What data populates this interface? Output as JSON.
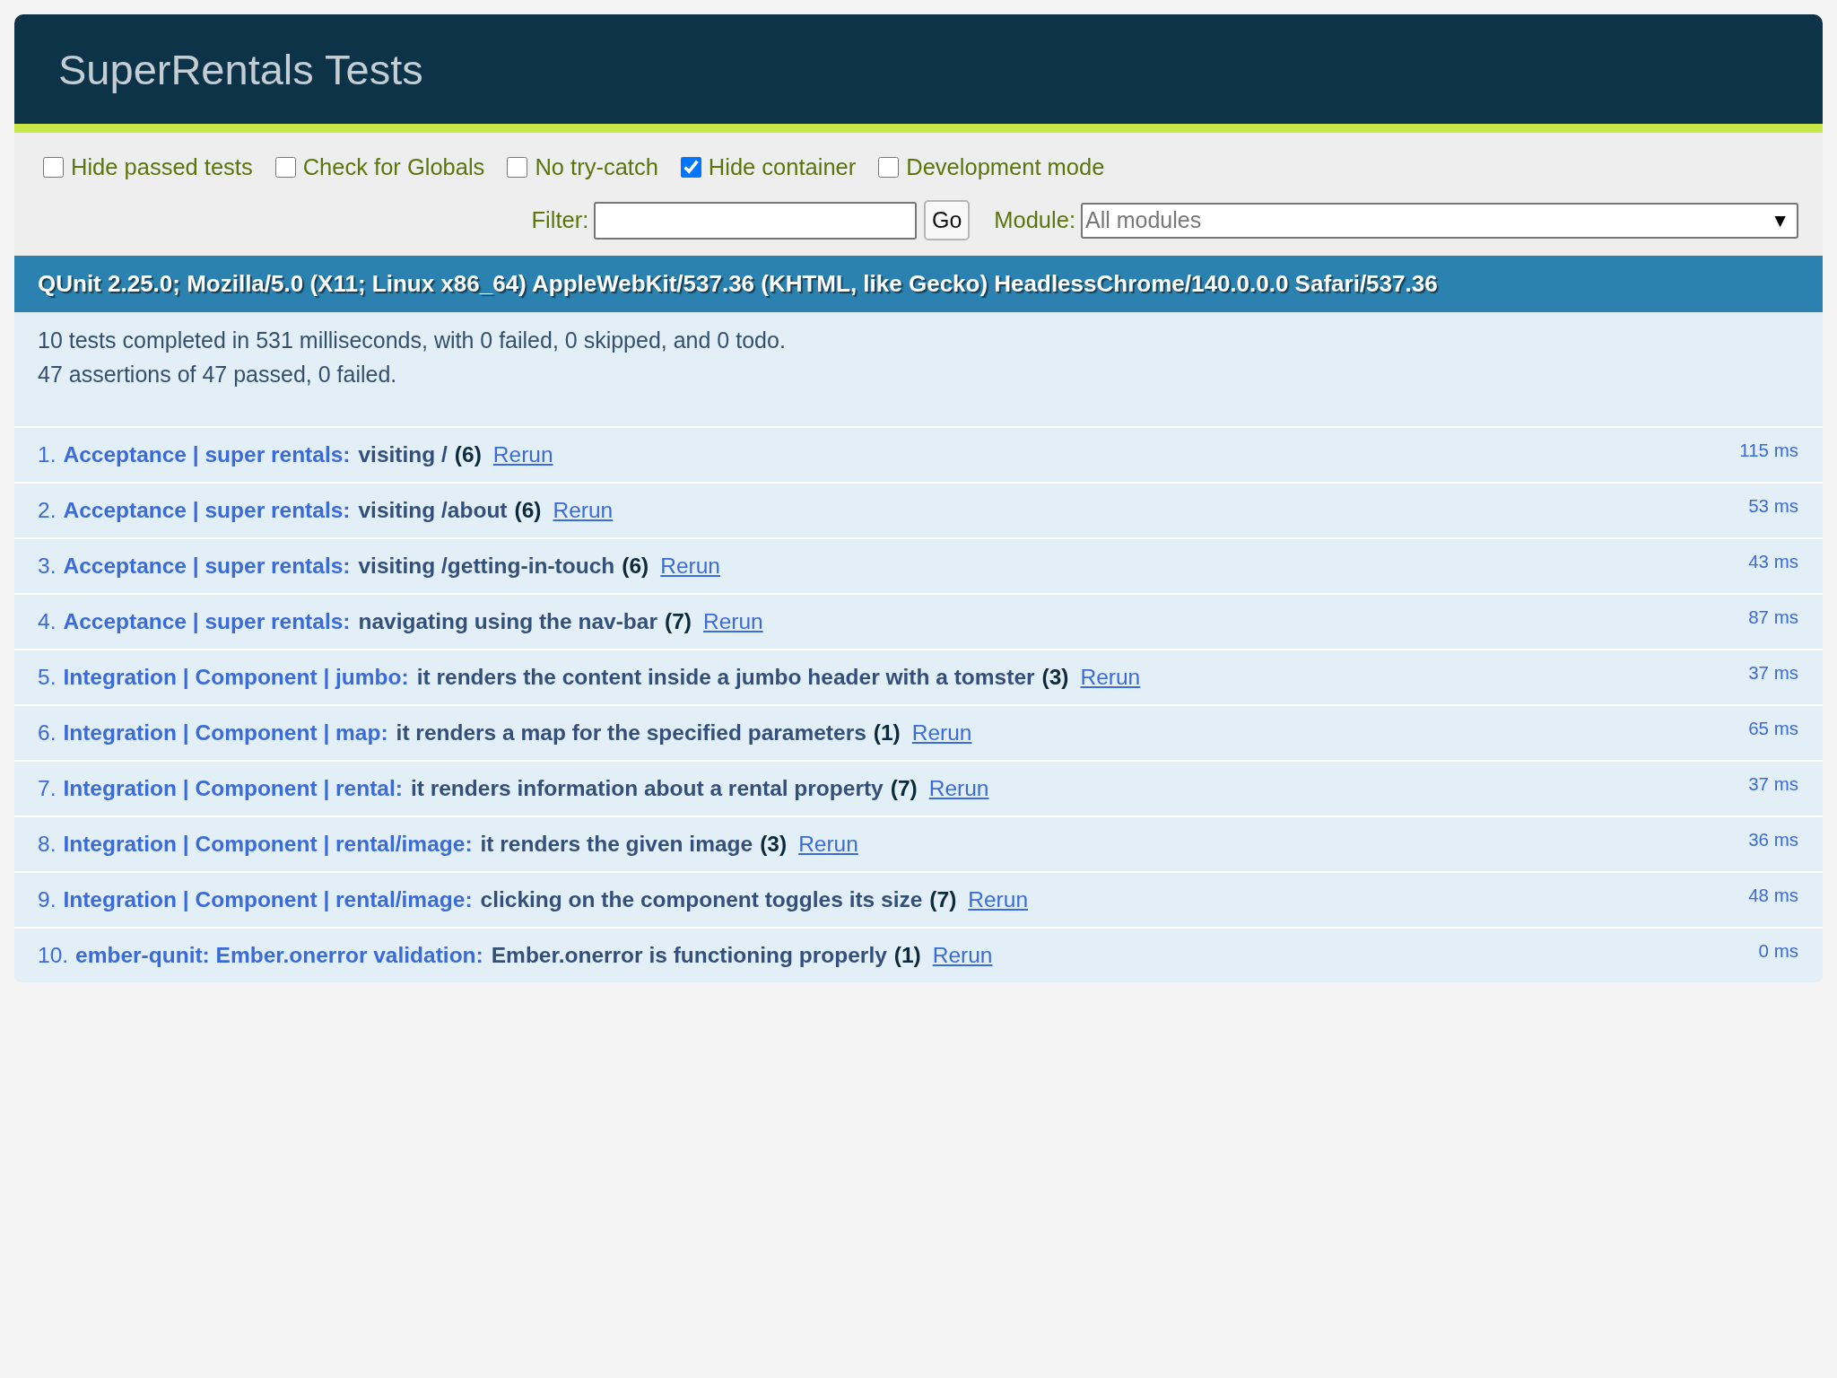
{
  "header": {
    "title": "SuperRentals Tests"
  },
  "toolbar": {
    "options": [
      {
        "label": "Hide passed tests",
        "checked": false
      },
      {
        "label": "Check for Globals",
        "checked": false
      },
      {
        "label": "No try-catch",
        "checked": false
      },
      {
        "label": "Hide container",
        "checked": true
      },
      {
        "label": "Development mode",
        "checked": false
      }
    ],
    "filter": {
      "label": "Filter:",
      "button": "Go"
    },
    "module": {
      "label": "Module:",
      "placeholder": "All modules",
      "arrow": "▼"
    }
  },
  "user_agent": "QUnit 2.25.0; Mozilla/5.0 (X11; Linux x86_64) AppleWebKit/537.36 (KHTML, like Gecko) HeadlessChrome/140.0.0.0 Safari/537.36",
  "summary": [
    "10 tests completed in 531 milliseconds, with 0 failed, 0 skipped, and 0 todo.",
    "47 assertions of 47 passed, 0 failed."
  ],
  "tests": [
    {
      "number": "1.",
      "module": "Acceptance | super rentals:",
      "name": "visiting /",
      "count": "(6)",
      "rerun": "Rerun",
      "runtime": "115 ms"
    },
    {
      "number": "2.",
      "module": "Acceptance | super rentals:",
      "name": "visiting /about",
      "count": "(6)",
      "rerun": "Rerun",
      "runtime": "53 ms"
    },
    {
      "number": "3.",
      "module": "Acceptance | super rentals:",
      "name": "visiting /getting-in-touch",
      "count": "(6)",
      "rerun": "Rerun",
      "runtime": "43 ms"
    },
    {
      "number": "4.",
      "module": "Acceptance | super rentals:",
      "name": "navigating using the nav-bar",
      "count": "(7)",
      "rerun": "Rerun",
      "runtime": "87 ms"
    },
    {
      "number": "5.",
      "module": "Integration | Component | jumbo:",
      "name": "it renders the content inside a jumbo header with a tomster",
      "count": "(3)",
      "rerun": "Rerun",
      "runtime": "37 ms"
    },
    {
      "number": "6.",
      "module": "Integration | Component | map:",
      "name": "it renders a map for the specified parameters",
      "count": "(1)",
      "rerun": "Rerun",
      "runtime": "65 ms"
    },
    {
      "number": "7.",
      "module": "Integration | Component | rental:",
      "name": "it renders information about a rental property",
      "count": "(7)",
      "rerun": "Rerun",
      "runtime": "37 ms"
    },
    {
      "number": "8.",
      "module": "Integration | Component | rental/image:",
      "name": "it renders the given image",
      "count": "(3)",
      "rerun": "Rerun",
      "runtime": "36 ms"
    },
    {
      "number": "9.",
      "module": "Integration | Component | rental/image:",
      "name": "clicking on the component toggles its size",
      "count": "(7)",
      "rerun": "Rerun",
      "runtime": "48 ms"
    },
    {
      "number": "10.",
      "module": "ember-qunit: Ember.onerror validation:",
      "name": "Ember.onerror is functioning properly",
      "count": "(1)",
      "rerun": "Rerun",
      "runtime": "0 ms"
    }
  ]
}
